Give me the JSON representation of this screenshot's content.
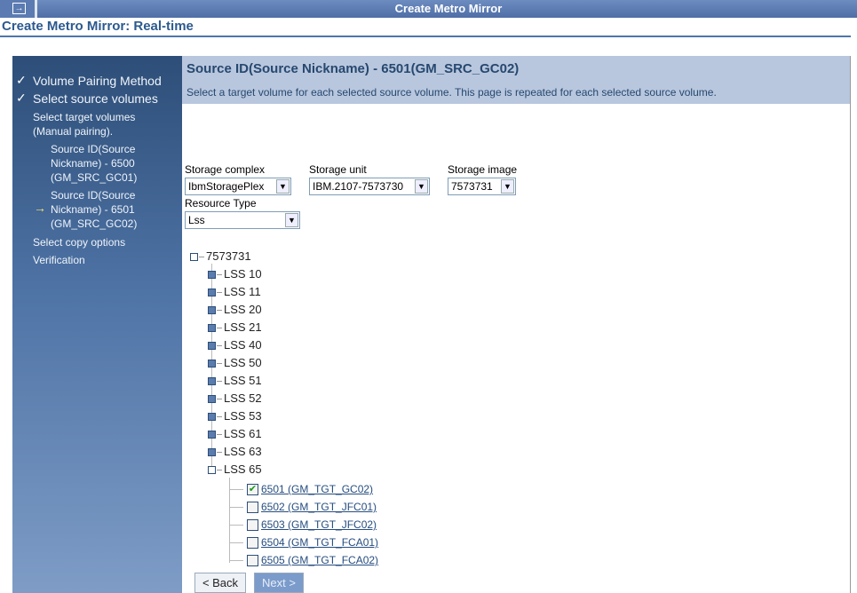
{
  "window": {
    "title": "Create Metro Mirror",
    "page_title": "Create Metro Mirror: Real-time"
  },
  "sidebar": {
    "items": [
      {
        "label": "Volume Pairing Method",
        "state": "done"
      },
      {
        "label": "Select source volumes",
        "state": "done"
      },
      {
        "label": "Select target volumes",
        "label2": "(Manual pairing)."
      },
      {
        "l1": "Source ID(Source",
        "l2": "Nickname) - 6500",
        "l3": "(GM_SRC_GC01)"
      },
      {
        "l1": "Source ID(Source",
        "l2": "Nickname) - 6501",
        "l3": "(GM_SRC_GC02)",
        "state": "current"
      },
      {
        "label": "Select copy options"
      },
      {
        "label": "Verification"
      }
    ]
  },
  "main": {
    "heading": "Source ID(Source Nickname) - 6501(GM_SRC_GC02)",
    "instructions": "Select a target volume for each selected source volume. This page is repeated for each selected source volume.",
    "storage_complex": {
      "label": "Storage complex",
      "value": "IbmStoragePlex"
    },
    "storage_unit": {
      "label": "Storage unit",
      "value": "IBM.2107-7573730"
    },
    "storage_image": {
      "label": "Storage image",
      "value": "7573731"
    },
    "resource_type": {
      "label": "Resource Type",
      "value": "Lss"
    },
    "tree": {
      "root": "7573731",
      "lss": [
        "LSS 10",
        "LSS 11",
        "LSS 20",
        "LSS 21",
        "LSS 40",
        "LSS 50",
        "LSS 51",
        "LSS 52",
        "LSS 53",
        "LSS 61",
        "LSS 63",
        "LSS 65"
      ],
      "volumes": [
        {
          "label": "6501 (GM_TGT_GC02)",
          "checked": true
        },
        {
          "label": "6502 (GM_TGT_JFC01)",
          "checked": false
        },
        {
          "label": "6503 (GM_TGT_JFC02)",
          "checked": false
        },
        {
          "label": "6504 (GM_TGT_FCA01)",
          "checked": false
        },
        {
          "label": "6505 (GM_TGT_FCA02)",
          "checked": false
        }
      ]
    },
    "back_label": "< Back",
    "next_label": "Next >"
  }
}
